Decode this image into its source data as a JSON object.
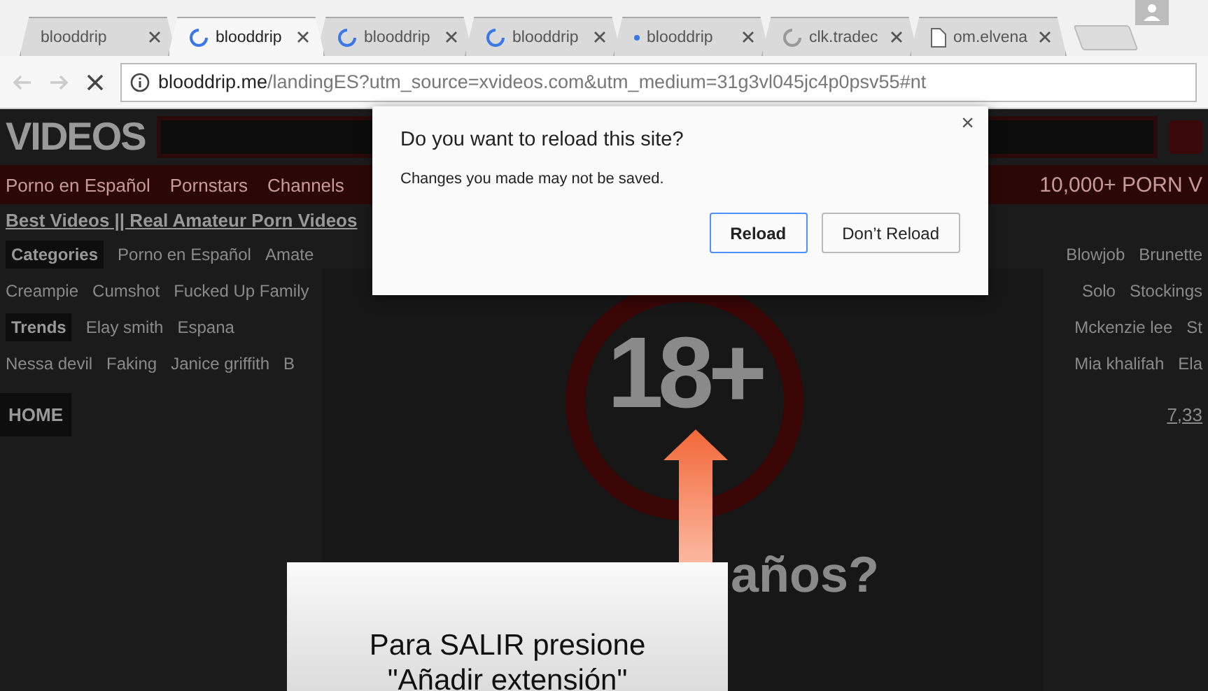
{
  "tabs": [
    {
      "title": "blooddrip",
      "kind": "plain",
      "selected": false
    },
    {
      "title": "blooddrip",
      "kind": "loading",
      "selected": true
    },
    {
      "title": "blooddrip",
      "kind": "loading",
      "selected": false
    },
    {
      "title": "blooddrip",
      "kind": "loading",
      "selected": false
    },
    {
      "title": "blooddrip",
      "kind": "dot",
      "selected": false
    },
    {
      "title": "clk.tradec",
      "kind": "waiting",
      "selected": false
    },
    {
      "title": "om.elvena",
      "kind": "page",
      "selected": false
    }
  ],
  "address": {
    "host": "blooddrip.me",
    "path": "/landingES?utm_source=xvideos.com&utm_medium=31g3vl045jc4p0psv55#nt"
  },
  "site": {
    "logo": "VIDEOS",
    "nav": [
      "Porno en Español",
      "Pornstars",
      "Channels"
    ],
    "nav_right": "10,000+ PORN V",
    "links": "Best Videos || Real Amateur Porn Videos",
    "rows": [
      {
        "kind": "label",
        "label": "Categories",
        "left": [
          "Porno en Español",
          "Amate"
        ],
        "right": [
          "Blowjob",
          "Brunette"
        ]
      },
      {
        "kind": "plain",
        "left": [
          "Creampie",
          "Cumshot",
          "Fucked Up Family"
        ],
        "right": [
          "Solo",
          "Stockings"
        ]
      },
      {
        "kind": "label",
        "label": "Trends",
        "left": [
          "Elay smith",
          "Espana"
        ],
        "right": [
          "Mckenzie lee",
          "St"
        ]
      },
      {
        "kind": "plain",
        "left": [
          "Nessa devil",
          "Faking",
          "Janice griffith",
          "B"
        ],
        "right": [
          "Mia khalifah",
          "Ela"
        ]
      }
    ],
    "home": "HOME",
    "count": "7,33"
  },
  "age_modal": {
    "badge": "18+",
    "question": "años?"
  },
  "callout": {
    "text": "Para SALIR presione \"Añadir extensión\""
  },
  "dialog": {
    "title": "Do you want to reload this site?",
    "message": "Changes you made may not be saved.",
    "close": "×",
    "buttons": [
      {
        "label": "Reload",
        "primary": true
      },
      {
        "label": "Don’t Reload",
        "primary": false
      }
    ]
  }
}
